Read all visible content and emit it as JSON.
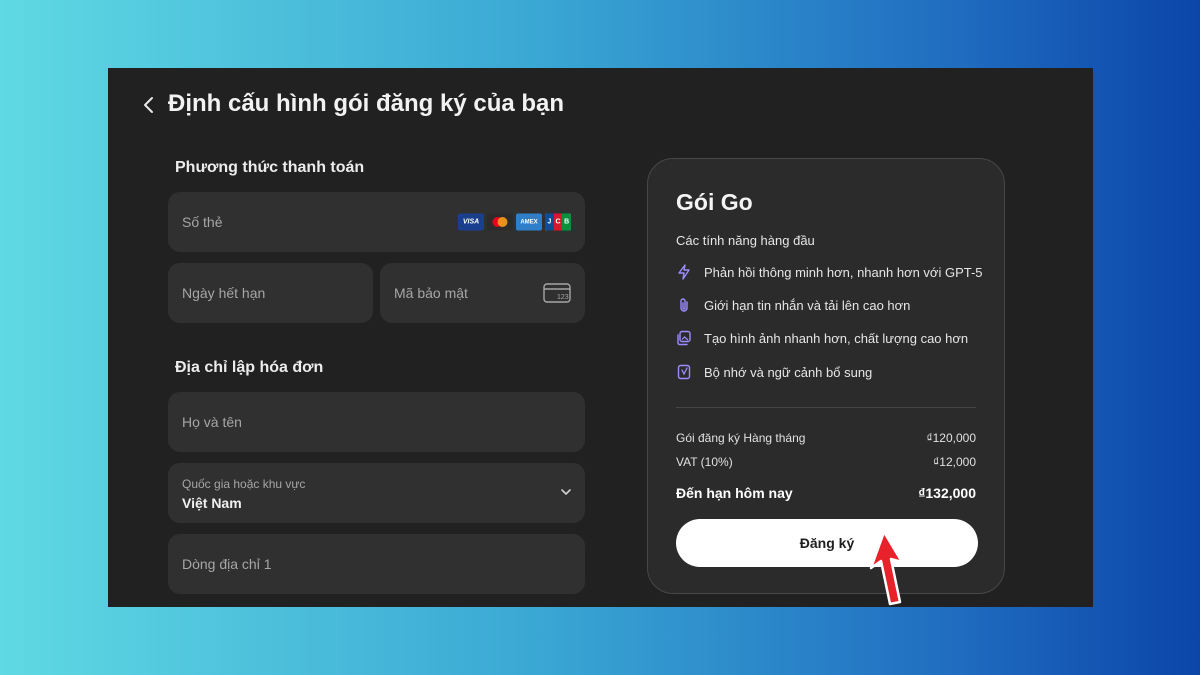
{
  "header": {
    "title": "Định cấu hình gói đăng ký của bạn"
  },
  "payment": {
    "section_title": "Phương thức thanh toán",
    "card_number_label": "Số thẻ",
    "card_brands": [
      "VISA",
      "mastercard",
      "AMEX",
      "JCB"
    ],
    "expiry_label": "Ngày hết hạn",
    "cvc_label": "Mã bảo mật",
    "cvc_icon_text": "123"
  },
  "billing": {
    "section_title": "Địa chỉ lập hóa đơn",
    "name_label": "Họ và tên",
    "country_label": "Quốc gia hoặc khu vực",
    "country_value": "Việt Nam",
    "address_label": "Dòng địa chỉ 1"
  },
  "plan": {
    "name": "Gói Go",
    "features_title": "Các tính năng hàng đầu",
    "features": [
      {
        "icon": "lightning-icon",
        "text": "Phản hồi thông minh hơn, nhanh hơn với GPT-5"
      },
      {
        "icon": "paperclip-icon",
        "text": "Giới hạn tin nhắn và tải lên cao hơn"
      },
      {
        "icon": "images-icon",
        "text": "Tạo hình ảnh nhanh hơn, chất lượng cao hơn"
      },
      {
        "icon": "memory-icon",
        "text": "Bộ nhớ và ngữ cảnh bổ sung"
      }
    ],
    "subscription_label": "Gói đăng ký Hàng tháng",
    "subscription_price": "₫120,000",
    "vat_label": "VAT (10%)",
    "vat_price": "₫12,000",
    "total_label": "Đến hạn hôm nay",
    "total_price": "₫132,000",
    "subscribe_label": "Đăng ký"
  },
  "colors": {
    "accent_icon": "#9b8cff",
    "annotation_arrow": "#e8222b",
    "panel_bg": "#212121",
    "field_bg": "#303030"
  }
}
